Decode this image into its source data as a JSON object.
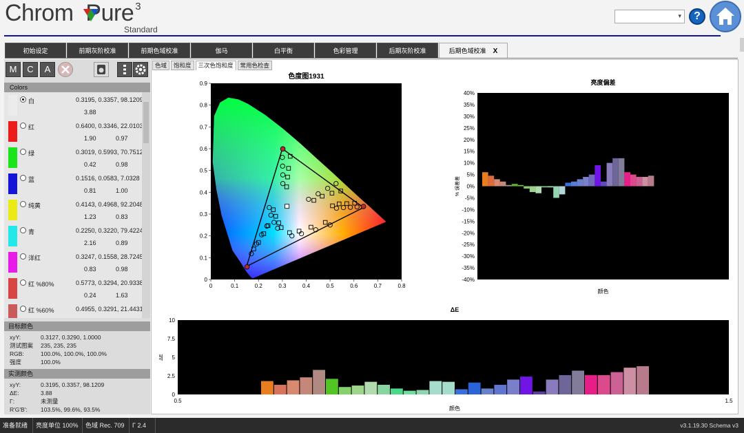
{
  "app": {
    "logo_text": "Chrom  Pure",
    "logo_sup": "3",
    "logo_sub": "Standard",
    "help_label": "?"
  },
  "tabs": [
    {
      "label": "初始设定"
    },
    {
      "label": "前期灰阶校准"
    },
    {
      "label": "前期色域校准"
    },
    {
      "label": "伽马"
    },
    {
      "label": "白平衡"
    },
    {
      "label": "色彩管理"
    },
    {
      "label": "后期灰阶校准"
    },
    {
      "label": "后期色域校准",
      "close": "X"
    }
  ],
  "toolbar": {
    "m": "M",
    "c": "C",
    "a": "A"
  },
  "colors_panel": {
    "title": "Colors",
    "items": [
      {
        "name": "白",
        "xy": "0.3195, 0.3357, 98.1209",
        "de": "3.88",
        "g": "",
        "swatch": "#ececec",
        "selected": true
      },
      {
        "name": "红",
        "xy": "0.6400, 0.3346, 22.0103",
        "de": "1.90",
        "g": "0.97",
        "swatch": "#ed1c1c"
      },
      {
        "name": "绿",
        "xy": "0.3019, 0.5993, 70.7512",
        "de": "0.42",
        "g": "0.98",
        "swatch": "#1ce41c"
      },
      {
        "name": "蓝",
        "xy": "0.1516, 0.0583, 7.0328",
        "de": "0.81",
        "g": "1.00",
        "swatch": "#1414d8"
      },
      {
        "name": "纯黄",
        "xy": "0.4143, 0.4968, 92.2048",
        "de": "1.23",
        "g": "0.83",
        "swatch": "#eaea14"
      },
      {
        "name": "青",
        "xy": "0.2250, 0.3220, 79.4224",
        "de": "2.16",
        "g": "0.89",
        "swatch": "#22e8ea"
      },
      {
        "name": "洋红",
        "xy": "0.3247, 0.1558, 28.7245",
        "de": "0.83",
        "g": "0.98",
        "swatch": "#e81ce8"
      },
      {
        "name": "红 %80%",
        "xy": "0.5773, 0.3294, 20.9338",
        "de": "0.24",
        "g": "1.63",
        "swatch": "#d84545"
      },
      {
        "name": "红 %60%",
        "xy": "0.4955, 0.3291, 21.4431",
        "de": "",
        "g": "",
        "swatch": "#c95b5b"
      }
    ]
  },
  "target": {
    "title": "目标颜色",
    "rows": [
      {
        "k": "xyY:",
        "v": "0.3127, 0.3290, 1.0000"
      },
      {
        "k": "测试图案",
        "v": "235, 235, 235"
      },
      {
        "k": "RGB:",
        "v": "100.0%, 100.0%, 100.0%"
      },
      {
        "k": "强度",
        "v": "100.0%"
      }
    ]
  },
  "measured": {
    "title": "实测颜色",
    "rows": [
      {
        "k": "xyY:",
        "v": "0.3195, 0.3357, 98.1209"
      },
      {
        "k": "ΔE:",
        "v": "3.88"
      },
      {
        "k": "Γ:",
        "v": "未测量"
      },
      {
        "k": "R'G'B':",
        "v": "103.5%, 99.6%, 93.5%"
      }
    ]
  },
  "subtabs": [
    {
      "label": "色域"
    },
    {
      "label": "饱和度"
    },
    {
      "label": "三次色饱和度",
      "active": true
    },
    {
      "label": "常用色检查"
    }
  ],
  "status": {
    "ready": "准备就绪",
    "lum": "亮度单位 100%",
    "gamut": "色域 Rec. 709",
    "gamma": "Γ  2.4",
    "version": "v3.1.19.30 Schema v3"
  },
  "chart_data": [
    {
      "type": "scatter",
      "title": "色度图1931",
      "xlim": [
        0,
        0.8
      ],
      "ylim": [
        0,
        0.9
      ],
      "x_ticks": [
        "0",
        "0.1",
        "0.2",
        "0.3",
        "0.4",
        "0.5",
        "0.6",
        "0.7",
        "0.8"
      ],
      "y_ticks": [
        "0",
        "0.1",
        "0.2",
        "0.3",
        "0.4",
        "0.5",
        "0.6",
        "0.7",
        "0.8",
        "0.9"
      ],
      "target_gamut": [
        [
          0.64,
          0.33
        ],
        [
          0.3,
          0.6
        ],
        [
          0.15,
          0.06
        ]
      ],
      "measured_gamut": [
        [
          0.64,
          0.335
        ],
        [
          0.302,
          0.599
        ],
        [
          0.152,
          0.058
        ]
      ],
      "target_points": [
        [
          0.613,
          0.333
        ],
        [
          0.585,
          0.331
        ],
        [
          0.556,
          0.33
        ],
        [
          0.527,
          0.327
        ],
        [
          0.3,
          0.56
        ],
        [
          0.301,
          0.52
        ],
        [
          0.302,
          0.48
        ],
        [
          0.302,
          0.44
        ],
        [
          0.17,
          0.118
        ],
        [
          0.192,
          0.163
        ],
        [
          0.213,
          0.205
        ],
        [
          0.235,
          0.245
        ],
        [
          0.525,
          0.44
        ],
        [
          0.49,
          0.418
        ],
        [
          0.45,
          0.393
        ],
        [
          0.41,
          0.368
        ],
        [
          0.245,
          0.33
        ],
        [
          0.252,
          0.295
        ],
        [
          0.265,
          0.262
        ],
        [
          0.28,
          0.235
        ],
        [
          0.5,
          0.25
        ],
        [
          0.44,
          0.228
        ],
        [
          0.38,
          0.21
        ],
        [
          0.34,
          0.2
        ]
      ],
      "measured_points": [
        [
          0.603,
          0.35
        ],
        [
          0.57,
          0.348
        ],
        [
          0.538,
          0.347
        ],
        [
          0.51,
          0.338
        ],
        [
          0.333,
          0.565
        ],
        [
          0.326,
          0.51
        ],
        [
          0.322,
          0.47
        ],
        [
          0.318,
          0.425
        ],
        [
          0.18,
          0.14
        ],
        [
          0.2,
          0.17
        ],
        [
          0.222,
          0.21
        ],
        [
          0.24,
          0.247
        ],
        [
          0.545,
          0.406
        ],
        [
          0.508,
          0.396
        ],
        [
          0.467,
          0.382
        ],
        [
          0.432,
          0.363
        ],
        [
          0.262,
          0.32
        ],
        [
          0.272,
          0.29
        ],
        [
          0.285,
          0.26
        ],
        [
          0.295,
          0.238
        ],
        [
          0.48,
          0.262
        ],
        [
          0.42,
          0.24
        ],
        [
          0.37,
          0.222
        ],
        [
          0.33,
          0.215
        ]
      ],
      "white_point": [
        0.3195,
        0.3357
      ]
    },
    {
      "type": "bar",
      "title": "亮度偏差",
      "xlabel": "颜色",
      "ylabel": "% 误差差",
      "ylim": [
        -40,
        40
      ],
      "y_ticks": [
        "40%",
        "35%",
        "30%",
        "25%",
        "20%",
        "15%",
        "10%",
        "5%",
        "0%",
        "-5%",
        "-10%",
        "-15%",
        "-20%",
        "-25%",
        "-30%",
        "-35%",
        "-40%"
      ],
      "values": [
        6,
        4.5,
        3,
        2,
        0.5,
        1,
        0.5,
        -1,
        -2.5,
        -3,
        -0.5,
        -0.5,
        -5,
        -3.5,
        1.5,
        2,
        3,
        4,
        5,
        9,
        2,
        10,
        12,
        12,
        6,
        5,
        4,
        4,
        4.5
      ],
      "colors": [
        "#e87e1f",
        "#dc6a3a",
        "#d88a70",
        "#c58a7a",
        "#a89a90",
        "#56b430",
        "#68c748",
        "#86cc6e",
        "#9ed08c",
        "#b1dbb0",
        "#7bd48c",
        "#a6dfb8",
        "#94d4b0",
        "#b3d6d8",
        "#3b6fdb",
        "#5a7ad6",
        "#6a80c8",
        "#7a7fcc",
        "#6f6bba",
        "#7015e6",
        "#5f4bbd",
        "#8a7bbd",
        "#6e6699",
        "#837c99",
        "#e71d88",
        "#db4a8a",
        "#cc6294",
        "#cd8fa4",
        "#b77b8c"
      ]
    },
    {
      "type": "bar",
      "title": "ΔE",
      "xlabel": "颜色",
      "ylabel": "ΔE",
      "ylim": [
        0,
        10
      ],
      "y_ticks": [
        "10",
        "7.5",
        "5",
        "2.5",
        "0"
      ],
      "x_ticks": [
        "0.5",
        "1.5"
      ],
      "values": [
        1.8,
        1.3,
        1.9,
        2.3,
        3.3,
        2.1,
        1.0,
        1.2,
        1.7,
        1.3,
        0.8,
        0.5,
        0.6,
        1.8,
        1.7,
        0.7,
        1.6,
        0.8,
        1.3,
        2.0,
        2.4,
        0.4,
        2.0,
        2.6,
        3.2,
        2.6,
        2.6,
        3.0,
        3.6,
        3.8
      ],
      "colors": [
        "#e87e1f",
        "#d8735e",
        "#d88a70",
        "#c4877a",
        "#b08a82",
        "#52c424",
        "#86d26a",
        "#9fd48c",
        "#b3dbb0",
        "#8ad4a0",
        "#4bd888",
        "#6ede9e",
        "#8ed6b0",
        "#a6dccc",
        "#a6dccc",
        "#3b6fdb",
        "#2b63d8",
        "#6a80c8",
        "#5f75d0",
        "#7a7fcc",
        "#7015e6",
        "#5c40a0",
        "#8a7bbd",
        "#6e6699",
        "#837c99",
        "#e71d88",
        "#db4a8a",
        "#cc6294",
        "#cd8fa4",
        "#b77b8c"
      ]
    }
  ]
}
